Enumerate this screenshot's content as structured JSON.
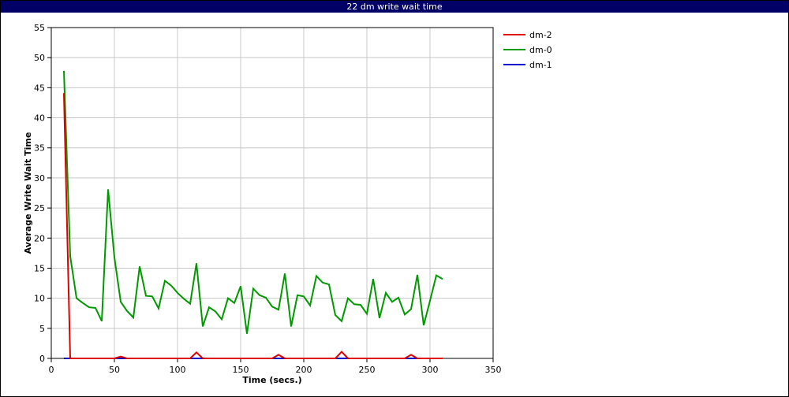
{
  "window": {
    "title": "22 dm write wait time"
  },
  "chart_data": {
    "type": "line",
    "title": "22 dm write wait time",
    "xlabel": "Time (secs.)",
    "ylabel": "Average Write Wait Time",
    "xlim": [
      0,
      350
    ],
    "ylim": [
      0,
      55
    ],
    "xticks": [
      0,
      50,
      100,
      150,
      200,
      250,
      300,
      350
    ],
    "yticks": [
      0,
      5,
      10,
      15,
      20,
      25,
      30,
      35,
      40,
      45,
      50,
      55
    ],
    "grid": true,
    "legend_position": "right",
    "series": [
      {
        "name": "dm-2",
        "color": "#e00000",
        "x": [
          10,
          15,
          20,
          25,
          30,
          35,
          40,
          45,
          50,
          55,
          60,
          65,
          70,
          75,
          80,
          85,
          90,
          95,
          100,
          105,
          110,
          115,
          120,
          125,
          130,
          135,
          140,
          145,
          150,
          155,
          160,
          165,
          170,
          175,
          180,
          185,
          190,
          195,
          200,
          205,
          210,
          215,
          220,
          225,
          230,
          235,
          240,
          245,
          250,
          255,
          260,
          265,
          270,
          275,
          280,
          285,
          290,
          295,
          300,
          305,
          310
        ],
        "y": [
          44.1,
          0,
          0,
          0,
          0,
          0,
          0,
          0,
          0,
          0.3,
          0,
          0,
          0,
          0,
          0,
          0,
          0,
          0,
          0,
          0,
          0,
          1.0,
          0,
          0,
          0,
          0,
          0,
          0,
          0,
          0,
          0,
          0,
          0,
          0,
          0.6,
          0,
          0,
          0,
          0,
          0,
          0,
          0,
          0,
          0,
          1.1,
          0,
          0,
          0,
          0,
          0,
          0,
          0,
          0,
          0,
          0,
          0.6,
          0,
          0,
          0,
          0,
          0
        ]
      },
      {
        "name": "dm-0",
        "color": "#009900",
        "x": [
          10,
          15,
          20,
          25,
          30,
          35,
          40,
          45,
          50,
          55,
          60,
          65,
          70,
          75,
          80,
          85,
          90,
          95,
          100,
          105,
          110,
          115,
          120,
          125,
          130,
          135,
          140,
          145,
          150,
          155,
          160,
          165,
          170,
          175,
          180,
          185,
          190,
          195,
          200,
          205,
          210,
          215,
          220,
          225,
          230,
          235,
          240,
          245,
          250,
          255,
          260,
          265,
          270,
          275,
          280,
          285,
          290,
          295,
          300,
          305,
          310
        ],
        "y": [
          47.8,
          17.0,
          10.0,
          9.2,
          8.5,
          8.4,
          6.2,
          28.1,
          16.8,
          9.4,
          7.9,
          6.8,
          15.3,
          10.4,
          10.3,
          8.3,
          12.9,
          12.1,
          10.9,
          9.9,
          9.1,
          15.8,
          5.3,
          8.5,
          7.8,
          6.5,
          10.0,
          9.2,
          12.0,
          4.1,
          11.6,
          10.5,
          10.1,
          8.6,
          8.1,
          14.1,
          5.3,
          10.5,
          10.3,
          8.8,
          13.7,
          12.6,
          12.3,
          7.2,
          6.2,
          10.0,
          9.0,
          8.9,
          7.4,
          13.2,
          6.7,
          10.9,
          9.4,
          10.1,
          7.3,
          8.2,
          13.9,
          5.5,
          9.6,
          13.8,
          13.2
        ]
      },
      {
        "name": "dm-1",
        "color": "#0000cc",
        "x": [
          10,
          15,
          20,
          25,
          30,
          35,
          40,
          45,
          50,
          55,
          60,
          65,
          70,
          75,
          80,
          85,
          90,
          95,
          100,
          105,
          110,
          115,
          120,
          125,
          130,
          135,
          140,
          145,
          150,
          155,
          160,
          165,
          170,
          175,
          180,
          185,
          190,
          195,
          200,
          205,
          210,
          215,
          220,
          225,
          230,
          235,
          240,
          245,
          250,
          255,
          260,
          265,
          270,
          275,
          280,
          285,
          290,
          295,
          300,
          305,
          310
        ],
        "y": [
          0,
          0,
          0,
          0,
          0,
          0,
          0,
          0,
          0,
          0,
          0,
          0,
          0,
          0,
          0,
          0,
          0,
          0,
          0,
          0,
          0,
          0,
          0,
          0,
          0,
          0,
          0,
          0,
          0,
          0,
          0,
          0,
          0,
          0,
          0,
          0,
          0,
          0,
          0,
          0,
          0,
          0,
          0,
          0,
          0,
          0,
          0,
          0,
          0,
          0,
          0,
          0,
          0,
          0,
          0,
          0,
          0,
          0,
          0,
          0,
          0
        ]
      }
    ]
  }
}
